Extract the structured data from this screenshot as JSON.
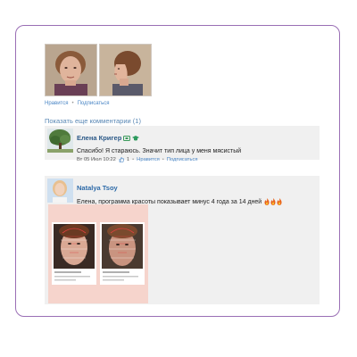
{
  "post": {
    "photos": [
      {
        "name": "before-photo",
        "icon": "woman-portrait-front"
      },
      {
        "name": "after-photo",
        "icon": "woman-portrait-side"
      }
    ],
    "like_label": "Нравится",
    "subscribe_label": "Подписаться",
    "show_more_label": "Показать еще комментарии (1)"
  },
  "comments": [
    {
      "author": "Елена Кригер",
      "text": "Спасибо! Я стараюсь. Значит тип лица у меня мясистый",
      "date": "Вт 05 Июл 10:22",
      "likes": "1",
      "like_label": "Нравится",
      "subscribe_label": "Подписаться",
      "badges": [
        "verified-icon",
        "graduation-cap-icon"
      ]
    },
    {
      "author": "Natalya Tsoy",
      "text": "Елена, программа красоты показывает минус 4 года за 14 дней",
      "emoji": [
        "fire-icon",
        "fire-icon",
        "fire-icon"
      ]
    }
  ],
  "colors": {
    "frame_border": "#9a6fb5",
    "link": "#4a86c5",
    "author": "#2d5a88",
    "comment_bg": "#f0f0f0"
  }
}
